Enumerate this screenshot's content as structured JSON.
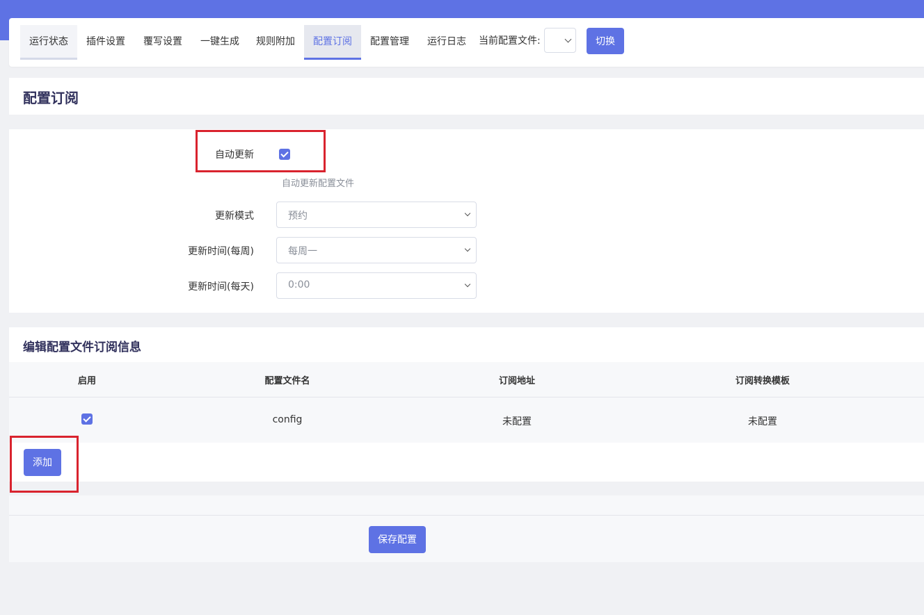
{
  "tabs": [
    {
      "label": "运行状态",
      "active": false
    },
    {
      "label": "插件设置",
      "active": false
    },
    {
      "label": "覆写设置",
      "active": false
    },
    {
      "label": "一键生成",
      "active": false
    },
    {
      "label": "规则附加",
      "active": false
    },
    {
      "label": "配置订阅",
      "active": true
    },
    {
      "label": "配置管理",
      "active": false
    },
    {
      "label": "运行日志",
      "active": false
    }
  ],
  "config_selector": {
    "label": "当前配置文件:",
    "value": "",
    "switch_label": "切换"
  },
  "page": {
    "title": "配置订阅"
  },
  "auto_update": {
    "label": "自动更新",
    "checked": true,
    "hint": "自动更新配置文件",
    "mode_label": "更新模式",
    "mode_value": "预约",
    "weekly_label": "更新时间(每周)",
    "weekly_value": "每周一",
    "daily_label": "更新时间(每天)",
    "daily_value": "0:00"
  },
  "subscription_table": {
    "title": "编辑配置文件订阅信息",
    "columns": [
      "启用",
      "配置文件名",
      "订阅地址",
      "订阅转换模板"
    ],
    "rows": [
      {
        "enabled": true,
        "name": "config",
        "url": "未配置",
        "template": "未配置"
      }
    ],
    "add_label": "添加"
  },
  "footer": {
    "save_label": "保存配置"
  },
  "colors": {
    "accent": "#5e72e4",
    "highlight_box": "#d9232e"
  }
}
